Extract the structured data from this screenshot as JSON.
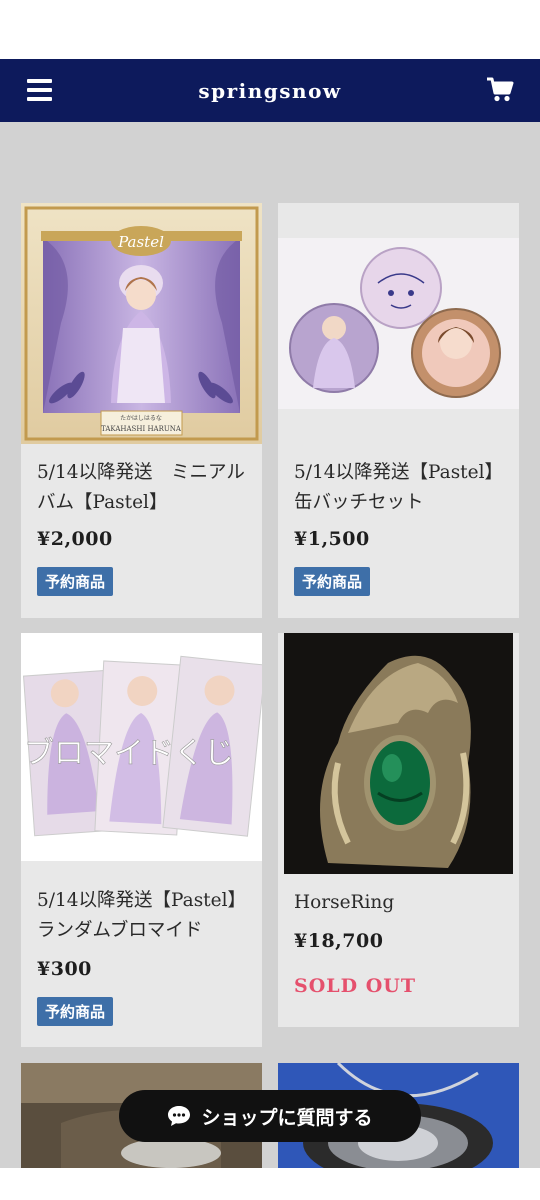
{
  "header": {
    "title": "springsnow",
    "menu_icon": "hamburger-menu-icon",
    "cart_icon": "shopping-cart-icon"
  },
  "colors": {
    "header_bg": "#0d1a5c",
    "badge_bg": "#3e6fa8",
    "sold_out": "#e5506d",
    "page_bg": "#d2d2d2",
    "card_bg": "#e8e8e8"
  },
  "products": [
    {
      "name": "5/14以降発送　ミニアルバム【Pastel】",
      "price": "¥2,000",
      "badge": "予約商品",
      "image_text": {
        "logo": "Pastel",
        "caption_small": "たかはしはるな",
        "caption": "TAKAHASHI HARUNA"
      }
    },
    {
      "name": "5/14以降発送【Pastel】缶バッチセット",
      "price": "¥1,500",
      "badge": "予約商品"
    },
    {
      "name": "5/14以降発送【Pastel】ランダムブロマイド",
      "price": "¥300",
      "badge": "予約商品",
      "image_text": {
        "overlay": "ブロマイドくじ"
      }
    },
    {
      "name": "HorseRing",
      "price": "¥18,700",
      "status": "SOLD OUT"
    }
  ],
  "chat_button": {
    "label": "ショップに質問する",
    "icon": "chat-bubble-icon"
  }
}
